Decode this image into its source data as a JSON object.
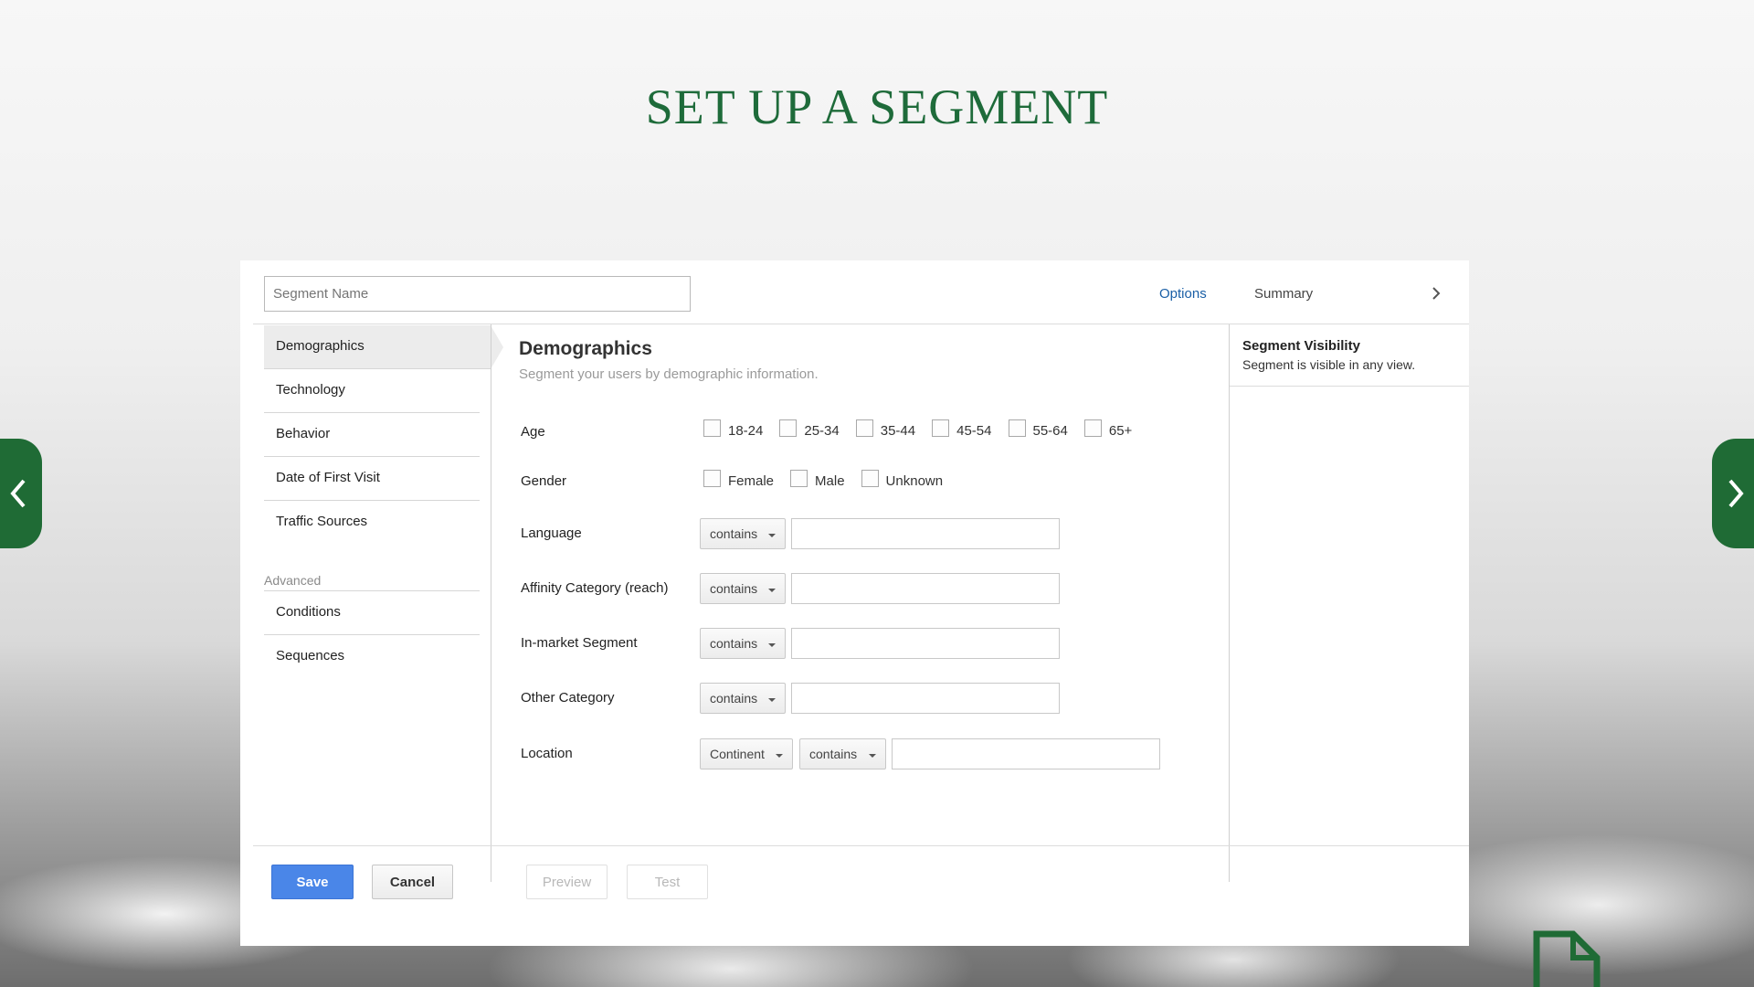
{
  "slide": {
    "title": "SET UP A SEGMENT",
    "title_color": "#1e6b3a",
    "nav_color": "#1f6b35",
    "prev_icon": "chevron-left-icon",
    "next_icon": "chevron-right-icon",
    "corner_icon": "document-icon"
  },
  "header": {
    "segment_name_placeholder": "Segment Name",
    "options_label": "Options",
    "summary_label": "Summary",
    "expand_icon": "chevron-right-icon"
  },
  "sidebar": {
    "items": [
      {
        "label": "Demographics",
        "active": true
      },
      {
        "label": "Technology"
      },
      {
        "label": "Behavior"
      },
      {
        "label": "Date of First Visit"
      },
      {
        "label": "Traffic Sources"
      }
    ],
    "advanced_heading": "Advanced",
    "advanced_items": [
      {
        "label": "Conditions"
      },
      {
        "label": "Sequences"
      }
    ]
  },
  "main": {
    "title": "Demographics",
    "subtitle": "Segment your users by demographic information.",
    "age": {
      "label": "Age",
      "options": [
        "18-24",
        "25-34",
        "35-44",
        "45-54",
        "55-64",
        "65+"
      ]
    },
    "gender": {
      "label": "Gender",
      "options": [
        "Female",
        "Male",
        "Unknown"
      ]
    },
    "language": {
      "label": "Language",
      "operator": "contains",
      "value": ""
    },
    "affinity": {
      "label": "Affinity Category (reach)",
      "operator": "contains",
      "value": ""
    },
    "inmarket": {
      "label": "In-market Segment",
      "operator": "contains",
      "value": ""
    },
    "other": {
      "label": "Other Category",
      "operator": "contains",
      "value": ""
    },
    "location": {
      "label": "Location",
      "scope": "Continent",
      "operator": "contains",
      "value": ""
    }
  },
  "visibility": {
    "title": "Segment Visibility",
    "description": "Segment is visible in any view."
  },
  "footer": {
    "save_label": "Save",
    "cancel_label": "Cancel",
    "preview_label": "Preview",
    "test_label": "Test",
    "save_color": "#4a86e8"
  }
}
